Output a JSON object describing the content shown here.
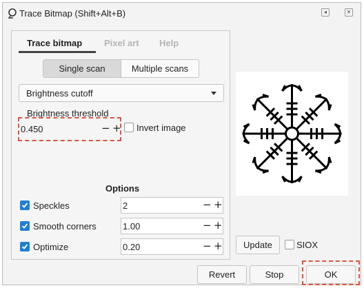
{
  "window": {
    "title": "Trace Bitmap (Shift+Alt+B)",
    "icon": "trace-bitmap-icon",
    "controls": [
      "restore-icon",
      "close-icon"
    ]
  },
  "tabs": [
    {
      "label": "Trace bitmap",
      "active": true
    },
    {
      "label": "Pixel art",
      "active": false
    },
    {
      "label": "Help",
      "active": false
    }
  ],
  "scan_mode": {
    "single": "Single scan",
    "multiple": "Multiple scans",
    "selected": "Single scan"
  },
  "mode_dropdown": {
    "value": "Brightness cutoff"
  },
  "threshold": {
    "label": "Brightness threshold",
    "value": "0.450",
    "minus": "−",
    "plus": "+"
  },
  "invert": {
    "label": "Invert image",
    "checked": false
  },
  "options": {
    "title": "Options",
    "rows": [
      {
        "label": "Speckles",
        "checked": true,
        "value": "2"
      },
      {
        "label": "Smooth corners",
        "checked": true,
        "value": "1.00"
      },
      {
        "label": "Optimize",
        "checked": true,
        "value": "0.20"
      }
    ]
  },
  "preview_panel": {
    "update_label": "Update",
    "siox_label": "SIOX",
    "siox_checked": false
  },
  "footer": {
    "revert": "Revert",
    "stop": "Stop",
    "ok": "OK"
  },
  "colors": {
    "accent": "#1f7fd6",
    "highlight": "#d9553f"
  }
}
